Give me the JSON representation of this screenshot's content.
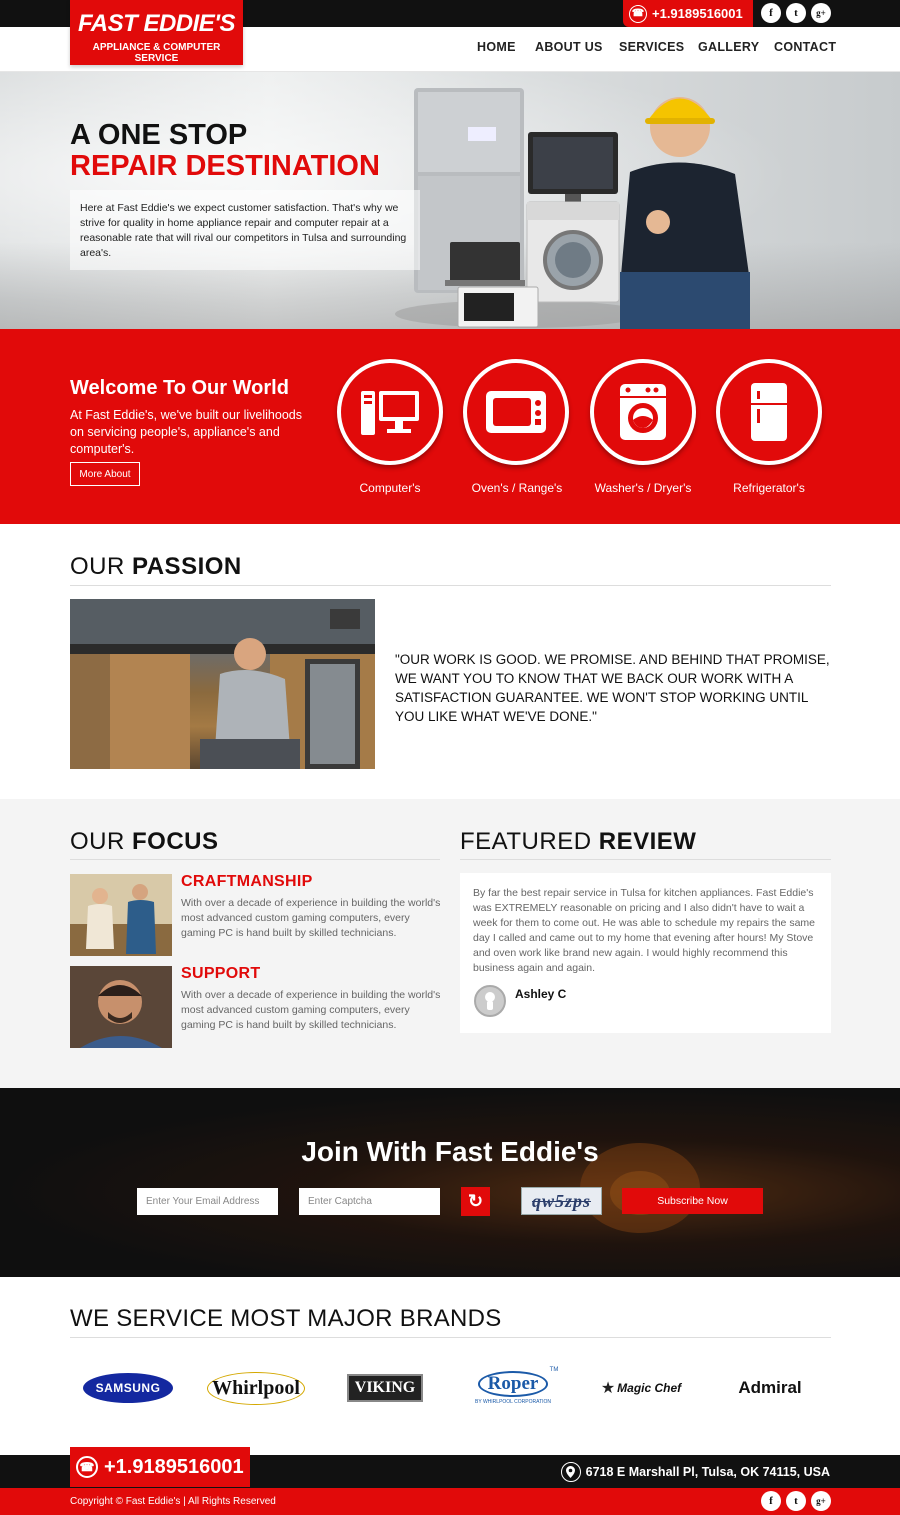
{
  "topbar": {
    "phone": "+1.9189516001",
    "social": [
      "f",
      "t",
      "g+"
    ]
  },
  "logo": {
    "name": "FAST EDDIE'S",
    "tagline": "APPLIANCE & COMPUTER SERVICE"
  },
  "nav": [
    "HOME",
    "ABOUT US",
    "SERVICES",
    "GALLERY",
    "CONTACT"
  ],
  "hero": {
    "line1": "A ONE STOP",
    "line2": "REPAIR DESTINATION",
    "text": "Here at Fast Eddie's we expect customer satisfaction. That's why we strive for quality in home appliance repair and computer repair at a reasonable rate that will rival our competitors in Tulsa and surrounding area's."
  },
  "welcome": {
    "title": "Welcome To Our World",
    "text": "At Fast Eddie's, we've built our livelihoods on servicing people's, appliance's and computer's.",
    "button": "More About",
    "services": [
      "Computer's",
      "Oven's / Range's",
      "Washer's / Dryer's",
      "Refrigerator's"
    ]
  },
  "passion": {
    "heading_light": "OUR ",
    "heading_bold": "PASSION",
    "quote": "\"OUR WORK IS GOOD. WE PROMISE. AND BEHIND THAT PROMISE, WE WANT YOU TO KNOW THAT WE BACK OUR WORK WITH A SATISFACTION GUARANTEE. WE WON'T STOP WORKING UNTIL YOU LIKE WHAT WE'VE DONE.\""
  },
  "focus": {
    "heading_light": "OUR ",
    "heading_bold": "FOCUS",
    "items": [
      {
        "title": "CRAFTMANSHIP",
        "text": "With over a decade of experience in building the world's most advanced custom gaming computers, every gaming PC is hand built by skilled technicians."
      },
      {
        "title": "SUPPORT",
        "text": "With over a decade of experience in building the world's most advanced custom gaming computers, every gaming PC is hand built by skilled technicians."
      }
    ]
  },
  "review": {
    "heading_light": "FEATURED ",
    "heading_bold": "REVIEW",
    "text": "By far the best repair service in Tulsa for kitchen appliances. Fast Eddie's was EXTREMELY reasonable on pricing and I also didn't have to wait a week for them to come out. He was able to schedule my repairs the same day I called and came out to my home that evening after hours! My Stove and oven work like brand new again. I would highly recommend this business again and again.",
    "author": "Ashley C"
  },
  "subscribe": {
    "title": "Join With Fast Eddie's",
    "email_placeholder": "Enter Your Email Address",
    "captcha_placeholder": "Enter Captcha",
    "captcha_text": "qw5zps",
    "button": "Subscribe Now"
  },
  "brands": {
    "heading": "WE SERVICE MOST MAJOR BRANDS",
    "list": [
      "SAMSUNG",
      "Whirlpool",
      "VIKING",
      "Roper",
      "Magic Chef",
      "Admiral"
    ],
    "roper_sub": "BY WHIRLPOOL CORPORATION",
    "roper_tm": "TM"
  },
  "footer": {
    "phone": "+1.9189516001",
    "address": "6718 E Marshall Pl, Tulsa, OK 74115, USA",
    "copyright": "Copyright © Fast Eddie's | All Rights Reserved"
  },
  "colors": {
    "brand_red": "#e10a0a",
    "dark": "#111111"
  }
}
